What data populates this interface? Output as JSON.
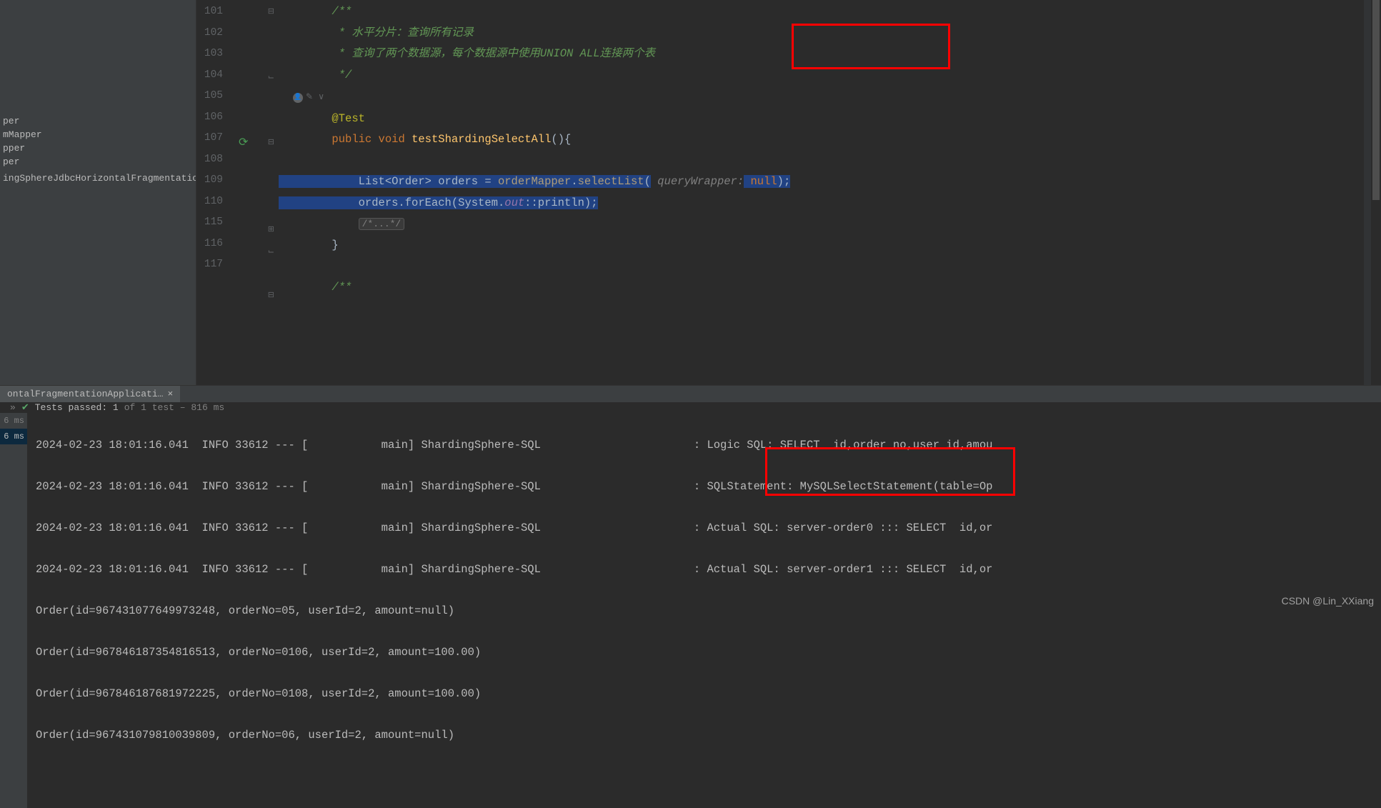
{
  "sidebar": {
    "items": [
      "per",
      "mMapper",
      "pper",
      "per",
      "",
      "ingSphereJdbcHorizontalFragmentation"
    ]
  },
  "gutter": {
    "lines": [
      "101",
      "102",
      "103",
      "104",
      "",
      "105",
      "106",
      "107",
      "108",
      "109",
      "110",
      "115",
      "116",
      "117"
    ]
  },
  "code": {
    "l101": "        /**",
    "l102": "         * 水平分片：查询所有记录",
    "l103": "         * 查询了两个数据源，每个数据源中使用UNION ALL连接两个表",
    "l104": "         */",
    "l105": "        @Test",
    "l106_kw1": "public",
    "l106_kw2": "void",
    "l106_method": "testShardingSelectAll",
    "l106_paren": "(){",
    "l108_a": "            List<Order> orders = ",
    "l108_b": "orderMapper",
    "l108_c": ".",
    "l108_d": "selectList",
    "l108_e": "(",
    "l108_param": "queryWrapper:",
    "l108_f": " null",
    "l108_g": ");",
    "l109_a": "            orders.forEach(System.",
    "l109_b": "out",
    "l109_c": "::println",
    "l109_d": ");",
    "l110_folded": "/*...*/",
    "l115": "        }",
    "l117": "        /**",
    "author_hint": "✎ ∨"
  },
  "bottom": {
    "tab": "ontalFragmentationApplicati…",
    "status_expand": "»",
    "status_check": "✔",
    "status_text": "Tests passed: 1",
    "status_dim": " of 1 test – 816 ms",
    "ms1": "6 ms",
    "ms2": "6 ms"
  },
  "console": {
    "l1": "2024-02-23 18:01:16.041  INFO 33612 --- [           main] ShardingSphere-SQL                       : Logic SQL: SELECT  id,order_no,user_id,amou",
    "l2": "2024-02-23 18:01:16.041  INFO 33612 --- [           main] ShardingSphere-SQL                       : SQLStatement: MySQLSelectStatement(table=Op",
    "l3": "2024-02-23 18:01:16.041  INFO 33612 --- [           main] ShardingSphere-SQL                       : Actual SQL: server-order0 ::: SELECT  id,or",
    "l4": "2024-02-23 18:01:16.041  INFO 33612 --- [           main] ShardingSphere-SQL                       : Actual SQL: server-order1 ::: SELECT  id,or",
    "l5": "Order(id=967431077649973248, orderNo=05, userId=2, amount=null)",
    "l6": "Order(id=967846187354816513, orderNo=0106, userId=2, amount=100.00)",
    "l7": "Order(id=967846187681972225, orderNo=0108, userId=2, amount=100.00)",
    "l8": "Order(id=967431079810039809, orderNo=06, userId=2, amount=null)"
  },
  "watermark": "CSDN @Lin_XXiang"
}
